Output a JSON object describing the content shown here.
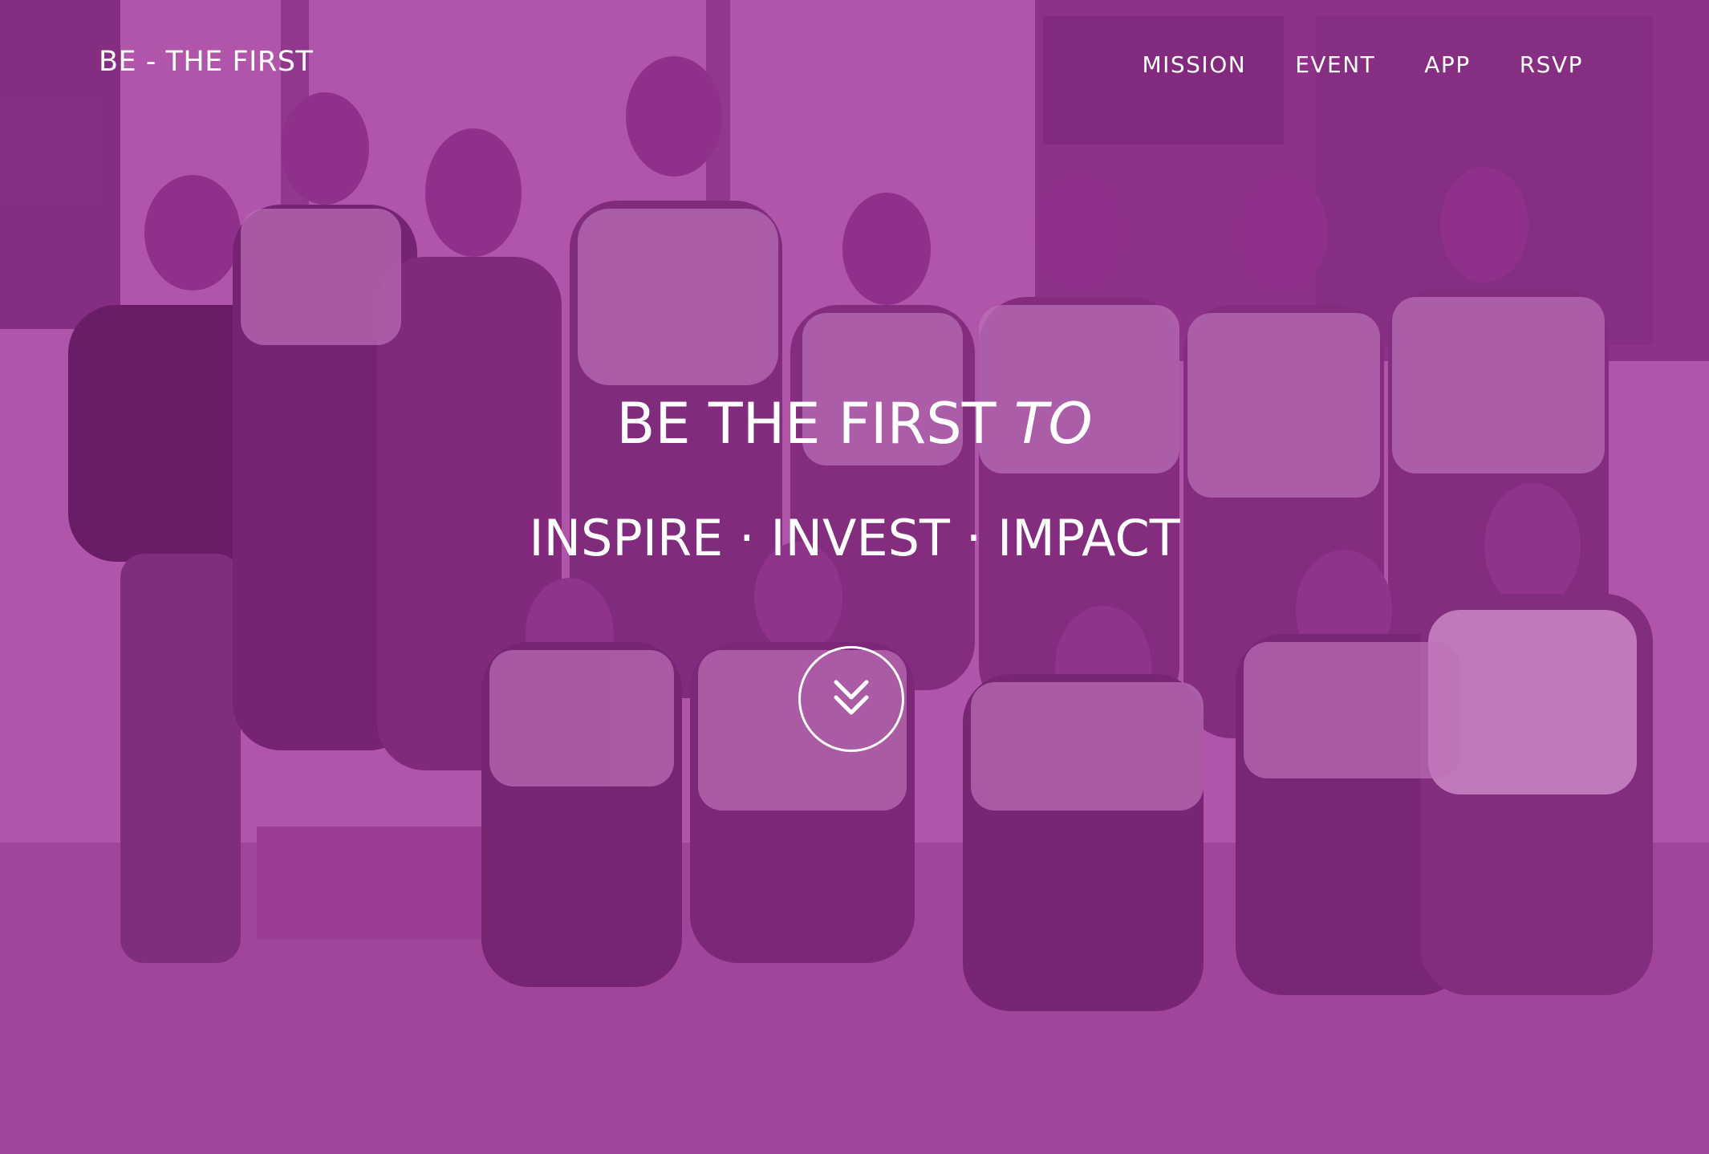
{
  "brand": {
    "title": "BE - THE FIRST"
  },
  "nav": {
    "items": [
      {
        "label": "MISSION"
      },
      {
        "label": "EVENT"
      },
      {
        "label": "APP"
      },
      {
        "label": "RSVP"
      }
    ]
  },
  "hero": {
    "headline_main": "BE THE FIRST ",
    "headline_emphasis": "TO",
    "subheadline": "INSPIRE · INVEST · IMPACT",
    "scroll_icon": "double-chevron-down-icon"
  },
  "colors": {
    "overlay": "#a3479e",
    "text": "#ffffff"
  }
}
